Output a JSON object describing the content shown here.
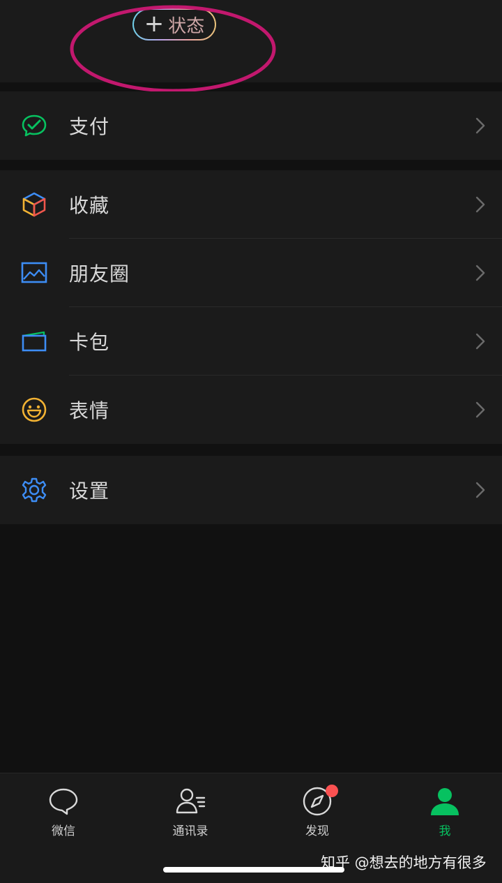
{
  "header": {
    "status_button": {
      "plus": "+",
      "label": "状态"
    }
  },
  "menu": {
    "pay": {
      "label": "支付",
      "icon": "pay-icon"
    },
    "favorites": {
      "label": "收藏",
      "icon": "favorites-cube-icon"
    },
    "moments": {
      "label": "朋友圈",
      "icon": "moments-picture-icon"
    },
    "cards": {
      "label": "卡包",
      "icon": "card-wallet-icon"
    },
    "stickers": {
      "label": "表情",
      "icon": "smiley-icon"
    },
    "settings": {
      "label": "设置",
      "icon": "gear-icon"
    }
  },
  "tabbar": {
    "chats": {
      "label": "微信",
      "icon": "chat-bubble-icon"
    },
    "contacts": {
      "label": "通讯录",
      "icon": "contacts-icon"
    },
    "discover": {
      "label": "发现",
      "icon": "compass-icon",
      "has_badge": true
    },
    "me": {
      "label": "我",
      "icon": "person-icon",
      "active": true
    }
  },
  "watermark": "知乎 @想去的地方有很多",
  "colors": {
    "accent": "#07c160",
    "badge": "#fa5151",
    "highlight_ellipse": "#c2186e",
    "background": "#111111",
    "surface": "#1b1b1b"
  }
}
